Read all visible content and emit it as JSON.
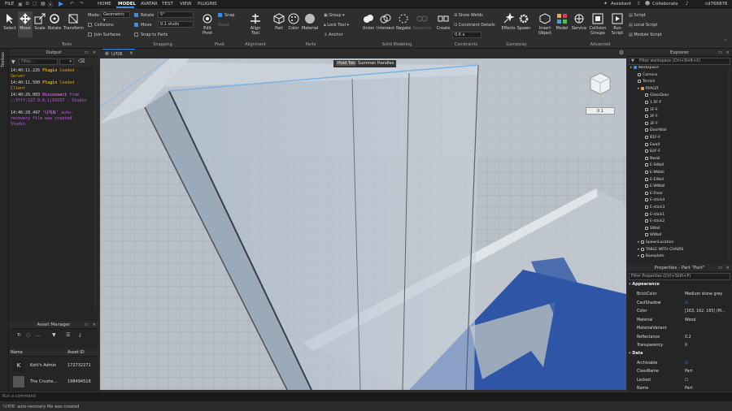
{
  "menu": {
    "file": "FILE",
    "tabs": [
      "HOME",
      "MODEL",
      "AVATAR",
      "TEST",
      "VIEW",
      "PLUGINS"
    ],
    "assistant": "Assistant",
    "collaborate": "Collaborate",
    "user": "cd766876"
  },
  "tools": {
    "select": "Select",
    "move": "Move",
    "scale": "Scale",
    "rotate": "Rotate",
    "transform": "Transform",
    "group": "Tools"
  },
  "mode": {
    "label": "Mode:",
    "value": "Geometric",
    "collisions": "Collisions",
    "join": "Join Surfaces"
  },
  "snapping": {
    "rotate": "Rotate",
    "rotate_val": "5°",
    "move": "Move",
    "move_val": "0.1 studs",
    "snap_parts": "Snap to Parts",
    "group": "Snapping"
  },
  "pivot": {
    "snap": "Snap",
    "reset": "Reset",
    "edit": "Edit\nPivot",
    "group": "Pivot"
  },
  "alignment": {
    "align": "Align\nTool",
    "group": "Alignment"
  },
  "parts": {
    "part": "Part",
    "color": "Color",
    "material": "Material",
    "group_btn": "Group",
    "lock": "Lock Tool",
    "anchor": "Anchor",
    "group": "Parts"
  },
  "solid": {
    "union": "Union",
    "intersect": "Intersect",
    "negate": "Negate",
    "separate": "Separate",
    "group": "Solid Modeling"
  },
  "constraints": {
    "create": "Create",
    "show_welds": "Show Welds",
    "details": "Constraint Details",
    "scale": "0.6 x",
    "group": "Constraints"
  },
  "gameplay": {
    "effects": "Effects",
    "spawn": "Spawn",
    "group": "Gameplay"
  },
  "advanced": {
    "insert": "Insert\nObject",
    "model": "Model",
    "service": "Service",
    "collision": "Collision\nGroups",
    "run": "Run\nScript",
    "group": "Advanced"
  },
  "scripts": [
    "Script",
    "Local Script",
    "Module Script"
  ],
  "toolbox": "Toolbox",
  "output": {
    "title": "Output",
    "filter": "Filter...",
    "lines": [
      {
        "t": "14:40:11.226",
        "msg": "Plugin",
        "suffix": "loaded  -  Server",
        "color": "#e0a020"
      },
      {
        "t": "14:40:11.500",
        "msg": "Plugin",
        "suffix": "loaded  -  Client",
        "color": "#e0a020"
      },
      {
        "t": "14:40:26.003",
        "msg": "Disconnect",
        "suffix": "from ::ffff:127.0.0.1|63157  -  Studio",
        "color": "#c060e0"
      },
      {
        "t": "14:46:28.497",
        "msg": "'나지트'",
        "suffix": "auto-recovery file was created  -  Studio",
        "color": "#c060e0"
      }
    ]
  },
  "asset_manager": {
    "title": "Asset Manager",
    "col_name": "Name",
    "col_id": "Asset ID",
    "rows": [
      {
        "name": "Kohl's Admin",
        "id": "172732271"
      },
      {
        "name": "The Crushe...",
        "id": "198494518"
      }
    ]
  },
  "doc_tab": "나지트",
  "viewport": {
    "hint_key": "Hold Tab",
    "hint_text": "Summon Handles",
    "scale": "0.1"
  },
  "explorer": {
    "title": "Explorer",
    "filter": "Filter workspace (Ctrl+Shift+X)",
    "items": [
      {
        "label": "Workspace",
        "depth": 0
      },
      {
        "label": "Camera",
        "depth": 1
      },
      {
        "label": "Terrain",
        "depth": 1
      },
      {
        "label": "RYAGIT",
        "depth": 1
      },
      {
        "label": "GlassDoor",
        "depth": 2
      },
      {
        "label": "1.5F-F",
        "depth": 2
      },
      {
        "label": "1F-F",
        "depth": 2
      },
      {
        "label": "2F-F",
        "depth": 2
      },
      {
        "label": "3F-F",
        "depth": 2
      },
      {
        "label": "DoorWall",
        "depth": 2
      },
      {
        "label": "B1F-F",
        "depth": 2
      },
      {
        "label": "Ewall",
        "depth": 2
      },
      {
        "label": "B2F-F",
        "depth": 2
      },
      {
        "label": "Nwall",
        "depth": 2
      },
      {
        "label": "E-SWall",
        "depth": 2
      },
      {
        "label": "E-NWall",
        "depth": 2
      },
      {
        "label": "E-EWall",
        "depth": 2
      },
      {
        "label": "E-WWall",
        "depth": 2
      },
      {
        "label": "E-Floor",
        "depth": 2
      },
      {
        "label": "E-stick4",
        "depth": 2
      },
      {
        "label": "E-stick3",
        "depth": 2
      },
      {
        "label": "E-stick1",
        "depth": 2
      },
      {
        "label": "E-stick2",
        "depth": 2
      },
      {
        "label": "SWall",
        "depth": 2
      },
      {
        "label": "WWall",
        "depth": 2
      },
      {
        "label": "SpawnLocation",
        "depth": 1
      },
      {
        "label": "TABLE WITH CHAIRS",
        "depth": 1
      },
      {
        "label": "Baseplate",
        "depth": 1
      }
    ]
  },
  "properties": {
    "title": "Properties - Part \"Part\"",
    "filter": "Filter Properties (Ctrl+Shift+P)",
    "sections": [
      {
        "name": "Appearance",
        "rows": [
          {
            "n": "BrickColor",
            "v": "Medium stone grey"
          },
          {
            "n": "CastShadow",
            "v": "☑"
          },
          {
            "n": "Color",
            "v": "[163, 162, 165] (M..."
          },
          {
            "n": "Material",
            "v": "Wood"
          },
          {
            "n": "MaterialVariant",
            "v": ""
          },
          {
            "n": "Reflectance",
            "v": "0.2"
          },
          {
            "n": "Transparency",
            "v": "0"
          }
        ]
      },
      {
        "name": "Data",
        "rows": [
          {
            "n": "Archivable",
            "v": "☑"
          },
          {
            "n": "ClassName",
            "v": "Part"
          },
          {
            "n": "Locked",
            "v": "☐"
          },
          {
            "n": "Name",
            "v": "Part"
          }
        ]
      }
    ]
  },
  "command": {
    "placeholder": "Run a command"
  },
  "status": "'나지트' auto-recovery file was created",
  "colors": {
    "accent": "#3a8ee6",
    "bg": "#2e2e2e",
    "panel": "#252525"
  }
}
